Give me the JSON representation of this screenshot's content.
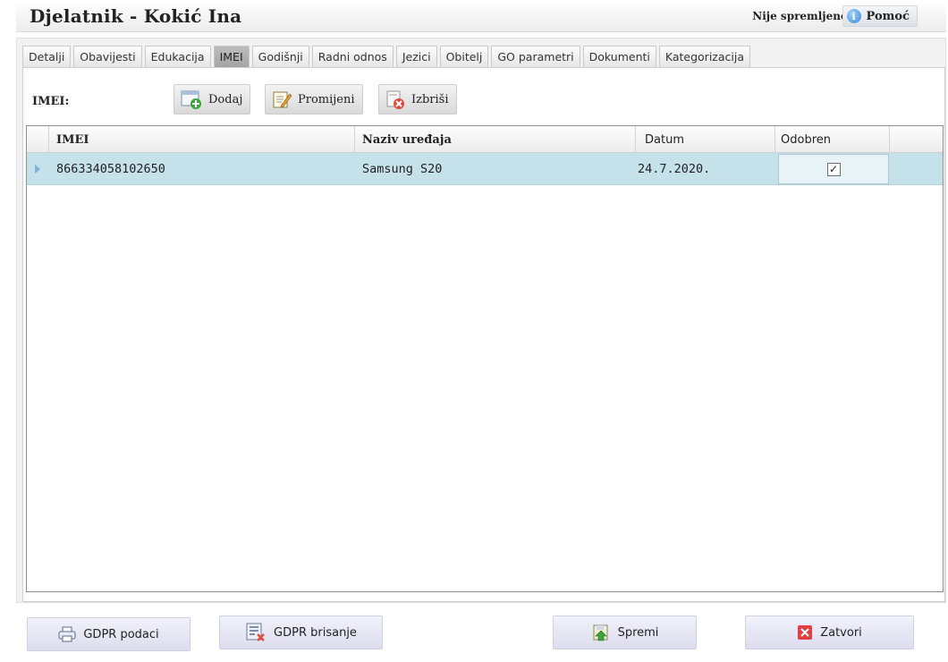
{
  "header": {
    "title": "Djelatnik - Kokić Ina",
    "status": "Nije spremljeno",
    "help_label": "Pomoć",
    "help_icon": "info-icon"
  },
  "tabs": [
    {
      "label": "Detalji"
    },
    {
      "label": "Obavijesti"
    },
    {
      "label": "Edukacija"
    },
    {
      "label": "IMEI",
      "active": true
    },
    {
      "label": "Godišnji"
    },
    {
      "label": "Radni odnos"
    },
    {
      "label": "Jezici"
    },
    {
      "label": "Obitelj"
    },
    {
      "label": "GO parametri"
    },
    {
      "label": "Dokumenti"
    },
    {
      "label": "Kategorizacija"
    }
  ],
  "toolbar": {
    "section_label": "IMEI:",
    "add_label": "Dodaj",
    "edit_label": "Promijeni",
    "delete_label": "Izbriši"
  },
  "grid": {
    "columns": [
      "IMEI",
      "Naziv uređaja",
      "Datum",
      "Odobren"
    ],
    "rows": [
      {
        "imei": "866334058102650",
        "device": "Samsung S20",
        "date": "24.7.2020.",
        "approved": true
      }
    ]
  },
  "footer": {
    "gdpr_data_label": "GDPR podaci",
    "gdpr_delete_label": "GDPR brisanje",
    "save_label": "Spremi",
    "close_label": "Zatvori"
  },
  "colors": {
    "selected_row": "#c5e1ea",
    "active_tab": "#b0b0b0",
    "close_red": "#e04040"
  }
}
